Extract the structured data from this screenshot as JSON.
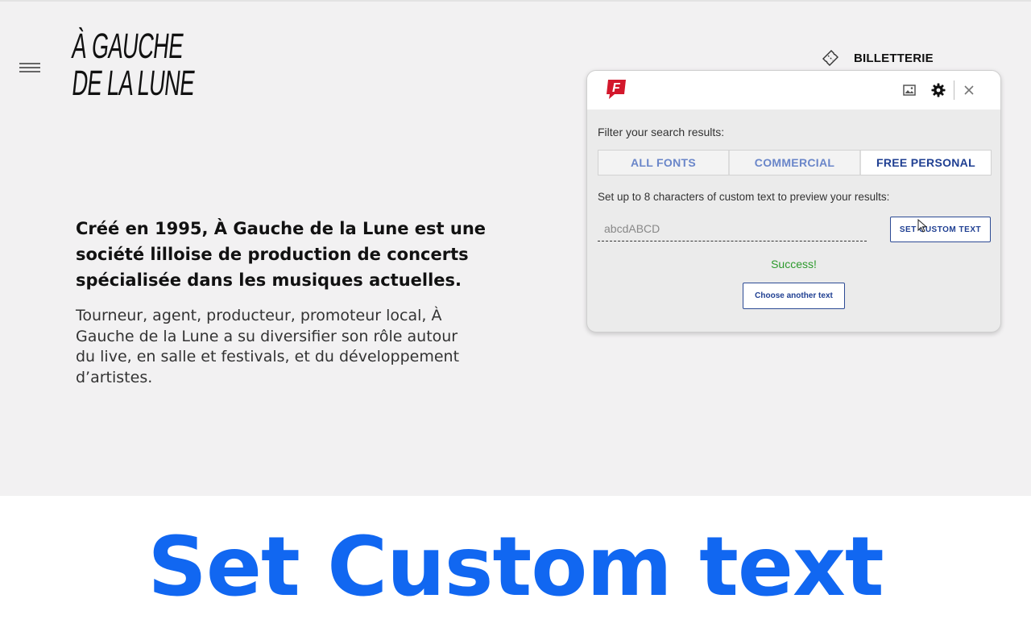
{
  "site": {
    "logo_line1": "À GAUCHE",
    "logo_line2": "DE LA LUNE",
    "ticket_label": "BILLETTERIE",
    "intro": "Créé en 1995, À Gauche de la Lune est une société lilloise de production de concerts spécialisée dans les musiques actuelles.",
    "body": "Tourneur, agent, producteur, promoteur local, À Gauche de la Lune a su diversifier son rôle autour du live, en salle et festivals, et du développement d’artistes."
  },
  "popup": {
    "brand_icon": "f-logo-icon",
    "filter_label": "Filter your search results:",
    "tabs": [
      {
        "label": "ALL FONTS",
        "active": false
      },
      {
        "label": "COMMERCIAL",
        "active": false
      },
      {
        "label": "FREE PERSONAL",
        "active": true
      }
    ],
    "custom_text_label": "Set up to 8 characters of custom text to preview your results:",
    "custom_text_value": "abcdABCD",
    "set_button_label": "SET CUSTOM TEXT",
    "success_message": "Success!",
    "choose_button_label": "Choose another text",
    "header_icons": [
      "image-icon",
      "gear-icon",
      "close-icon"
    ]
  },
  "caption": "Set Custom text",
  "colors": {
    "site_bg": "#f2f1f2",
    "popup_bg": "#ebebeb",
    "accent_blue": "#1f3f92",
    "inactive_tab": "#6a86c9",
    "success_green": "#2d9a2d",
    "caption_blue": "#1167f1",
    "brand_red": "#d3182c"
  }
}
